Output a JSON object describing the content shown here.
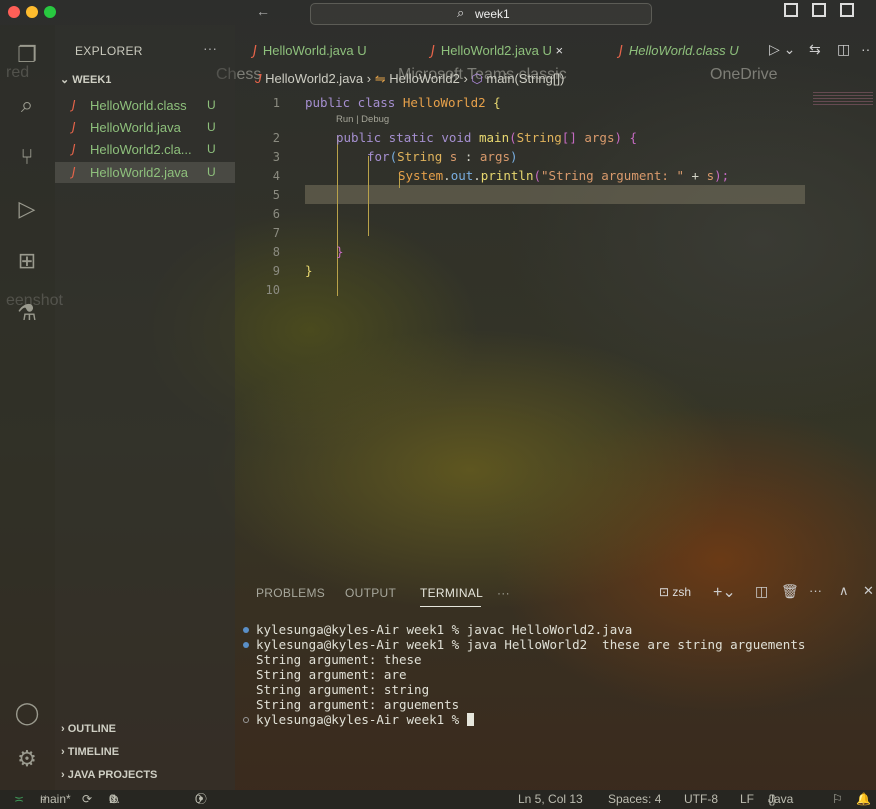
{
  "titlebar": {
    "search_text": "week1"
  },
  "sidebar": {
    "header": "EXPLORER",
    "folder": "WEEK1",
    "files": [
      {
        "icon": "J",
        "name": "HelloWorld.class",
        "status": "U"
      },
      {
        "icon": "J",
        "name": "HelloWorld.java",
        "status": "U"
      },
      {
        "icon": "J",
        "name": "HelloWorld2.cla...",
        "status": "U"
      },
      {
        "icon": "J",
        "name": "HelloWorld2.java",
        "status": "U"
      }
    ],
    "sections": [
      "OUTLINE",
      "TIMELINE",
      "JAVA PROJECTS"
    ]
  },
  "tabs": [
    {
      "icon": "J",
      "name": "HelloWorld.java",
      "status": "U"
    },
    {
      "icon": "J",
      "name": "HelloWorld2.java",
      "status": "U",
      "close": "×"
    },
    {
      "icon": "J",
      "name": "HelloWorld.class",
      "status": "U"
    }
  ],
  "breadcrumb": {
    "file": "HelloWorld2.java",
    "class": "HelloWorld2",
    "method": "main(String[])"
  },
  "code": {
    "line_numbers": [
      "1",
      "2",
      "3",
      "4",
      "5",
      "6",
      "7",
      "8",
      "9",
      "10"
    ],
    "codelens": "Run | Debug",
    "l1": {
      "kw": "public class ",
      "cls": "HelloWorld2",
      "rest": " {"
    },
    "l2": {
      "kw": "public static void ",
      "fn": "main",
      "p1": "(",
      "ty": "String",
      "br": "[] ",
      "vr": "args",
      "p2": ") {"
    },
    "l3": {
      "kw": "for",
      "p1": "(",
      "ty": "String",
      "vr": " s ",
      "op": ": ",
      "vr2": "args",
      "p2": ")"
    },
    "l4": {
      "cl": "System",
      "d1": ".",
      "vr": "out",
      "d2": ".",
      "fn": "println",
      "p1": "(",
      "sr": "\"String argument: \"",
      "op": " + ",
      "vr2": "s",
      "p2": ");"
    },
    "l8": "}",
    "l9": "}"
  },
  "panel": {
    "tabs": [
      "PROBLEMS",
      "OUTPUT",
      "TERMINAL",
      "···"
    ],
    "shell": "zsh",
    "lines": [
      "kylesunga@kyles-Air week1 % javac HelloWorld2.java",
      "kylesunga@kyles-Air week1 % java HelloWorld2  these are string arguements",
      "String argument: these",
      "String argument: are",
      "String argument: string",
      "String argument: arguements",
      "kylesunga@kyles-Air week1 % "
    ]
  },
  "status": {
    "branch": "main*",
    "errors": "0",
    "warnings": "0",
    "ports": "0",
    "position": "Ln 5, Col 13",
    "spaces": "Spaces: 4",
    "encoding": "UTF-8",
    "eol": "LF",
    "language": "Java"
  },
  "desktop_overlays": [
    "red",
    "Chess",
    "Microsoft Teams classic",
    "OneDrive",
    "eenshot"
  ],
  "colors": {
    "accent": "#e6644a",
    "git_untracked": "#8ec07c",
    "keyword": "#a58fd0"
  }
}
